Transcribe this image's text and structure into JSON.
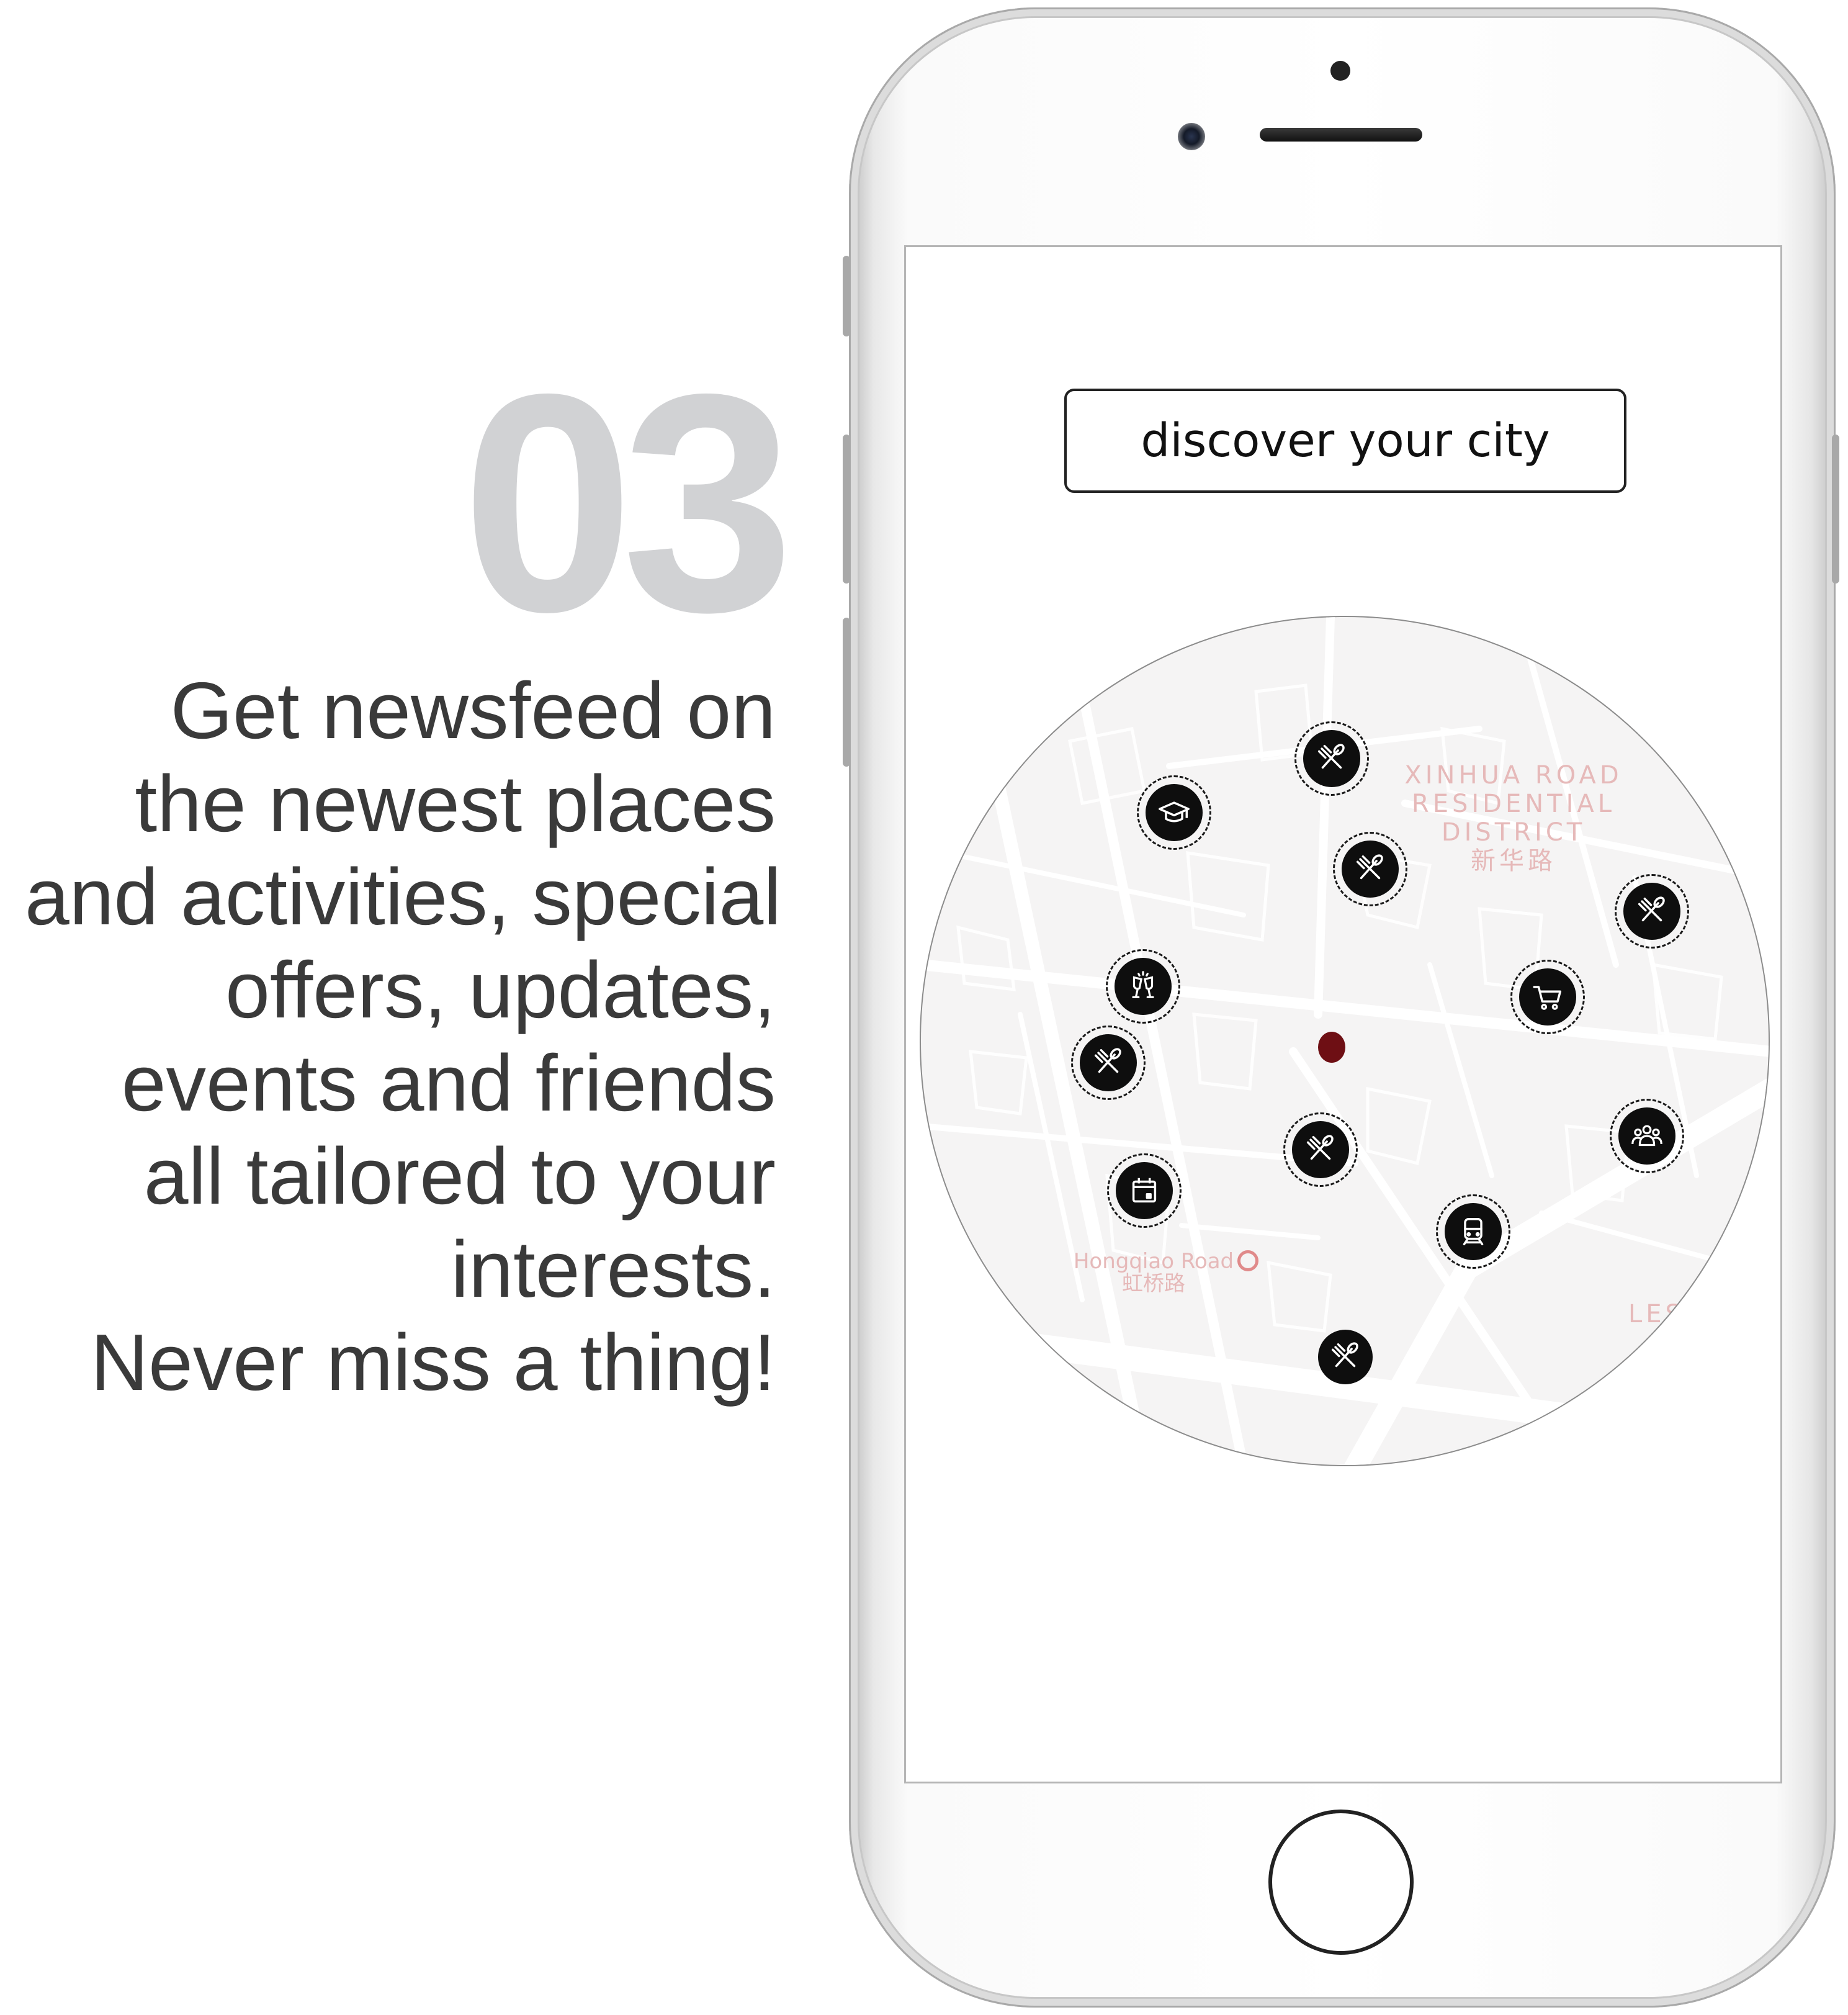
{
  "feature": {
    "step_number": "03",
    "lines": [
      "Get newsfeed on",
      "the newest places",
      "and activities, special",
      "offers, updates,",
      "events and friends",
      "all tailored to your",
      "interests.",
      "Never miss a thing!"
    ]
  },
  "app": {
    "search_label": "discover your city",
    "map": {
      "district_label": [
        "XINHUA ROAD",
        "RESIDENTIAL",
        "DISTRICT",
        "新华路"
      ],
      "station_label": [
        "Hongqiao Road",
        "虹桥路"
      ],
      "edge_label": "LES",
      "markers": [
        {
          "icon": "restaurant-icon"
        },
        {
          "icon": "education-icon"
        },
        {
          "icon": "restaurant-icon"
        },
        {
          "icon": "restaurant-icon"
        },
        {
          "icon": "nightlife-icon"
        },
        {
          "icon": "shopping-cart-icon"
        },
        {
          "icon": "restaurant-icon"
        },
        {
          "icon": "restaurant-icon"
        },
        {
          "icon": "group-icon"
        },
        {
          "icon": "event-calendar-icon"
        },
        {
          "icon": "metro-train-icon"
        },
        {
          "icon": "restaurant-icon"
        }
      ]
    }
  },
  "colors": {
    "step_number": "#d1d2d4",
    "body_text": "#3a3a3a",
    "marker_fill": "#0e0e0e",
    "user_location": "#6e0f14",
    "map_background": "#f5f4f4",
    "map_label": "#e6b9b9"
  }
}
